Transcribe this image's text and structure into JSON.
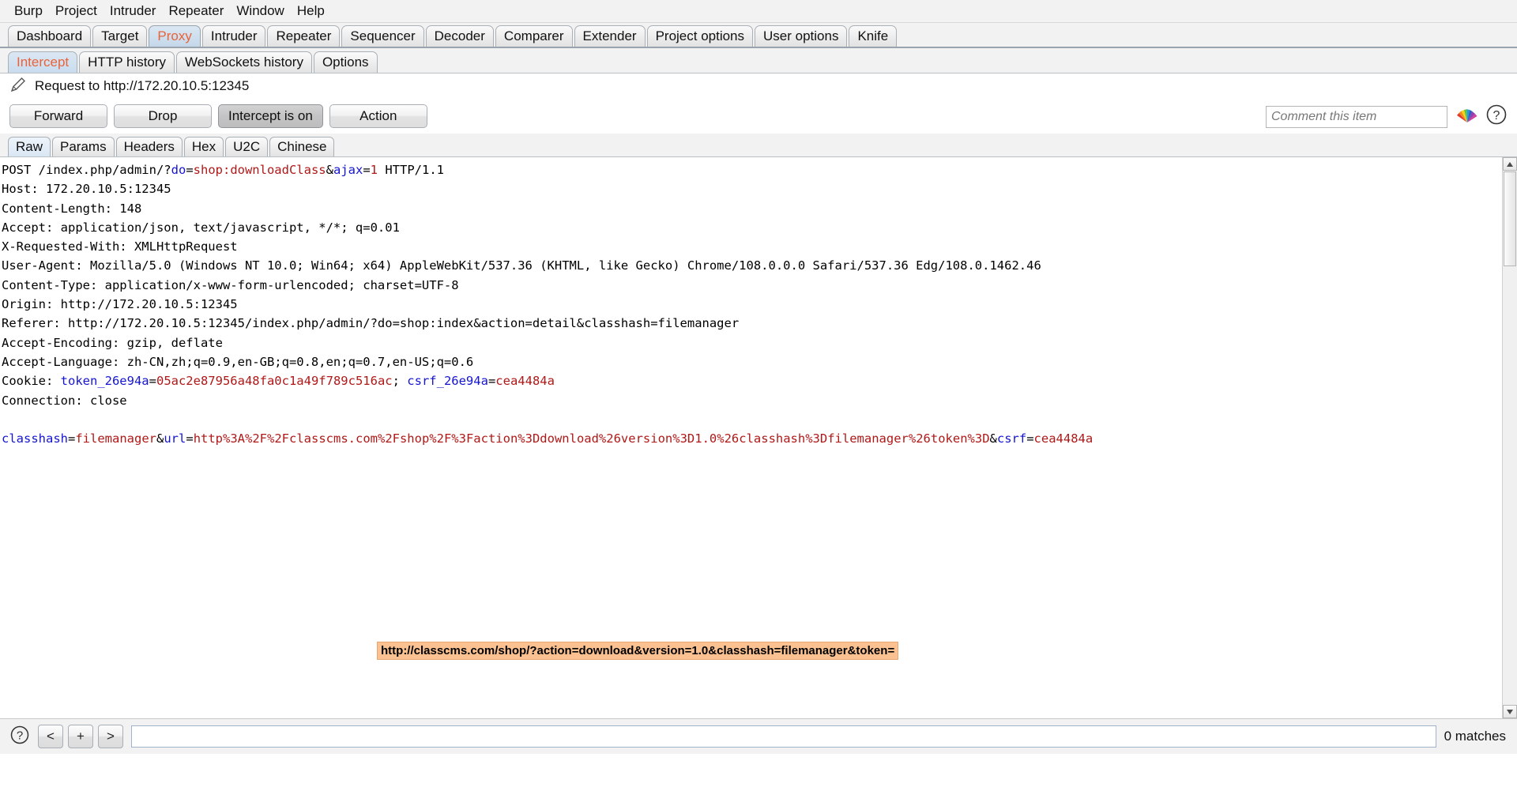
{
  "menubar": {
    "items": [
      "Burp",
      "Project",
      "Intruder",
      "Repeater",
      "Window",
      "Help"
    ]
  },
  "main_tabs": {
    "selected": "Proxy",
    "items": [
      "Dashboard",
      "Target",
      "Proxy",
      "Intruder",
      "Repeater",
      "Sequencer",
      "Decoder",
      "Comparer",
      "Extender",
      "Project options",
      "User options",
      "Knife"
    ]
  },
  "sub_tabs": {
    "selected": "Intercept",
    "items": [
      "Intercept",
      "HTTP history",
      "WebSockets history",
      "Options"
    ]
  },
  "request_header": {
    "icon": "pencil-icon",
    "title": "Request to http://172.20.10.5:12345"
  },
  "action_bar": {
    "forward_label": "Forward",
    "drop_label": "Drop",
    "intercept_label": "Intercept is on",
    "action_label": "Action",
    "comment_placeholder": "Comment this item",
    "comment_value": "",
    "fan_icon": "highlighter-fan-icon",
    "help_icon": "help-icon"
  },
  "editor_tabs": {
    "selected": "Raw",
    "items": [
      "Raw",
      "Params",
      "Headers",
      "Hex",
      "U2C",
      "Chinese"
    ]
  },
  "request": {
    "lines": [
      [
        {
          "t": "POST /index.php/admin/?",
          "c": "plain"
        },
        {
          "t": "do",
          "c": "blue"
        },
        {
          "t": "=",
          "c": "plain"
        },
        {
          "t": "shop:downloadClass",
          "c": "red"
        },
        {
          "t": "&",
          "c": "plain"
        },
        {
          "t": "ajax",
          "c": "blue"
        },
        {
          "t": "=",
          "c": "plain"
        },
        {
          "t": "1",
          "c": "red"
        },
        {
          "t": " HTTP/1.1",
          "c": "plain"
        }
      ],
      [
        {
          "t": "Host: 172.20.10.5:12345",
          "c": "plain"
        }
      ],
      [
        {
          "t": "Content-Length: 148",
          "c": "plain"
        }
      ],
      [
        {
          "t": "Accept: application/json, text/javascript, */*; q=0.01",
          "c": "plain"
        }
      ],
      [
        {
          "t": "X-Requested-With: XMLHttpRequest",
          "c": "plain"
        }
      ],
      [
        {
          "t": "User-Agent: Mozilla/5.0 (Windows NT 10.0; Win64; x64) AppleWebKit/537.36 (KHTML, like Gecko) Chrome/108.0.0.0 Safari/537.36 Edg/108.0.1462.46",
          "c": "plain"
        }
      ],
      [
        {
          "t": "Content-Type: application/x-www-form-urlencoded; charset=UTF-8",
          "c": "plain"
        }
      ],
      [
        {
          "t": "Origin: http://172.20.10.5:12345",
          "c": "plain"
        }
      ],
      [
        {
          "t": "Referer: http://172.20.10.5:12345/index.php/admin/?do=shop:index&action=detail&classhash=filemanager",
          "c": "plain"
        }
      ],
      [
        {
          "t": "Accept-Encoding: gzip, deflate",
          "c": "plain"
        }
      ],
      [
        {
          "t": "Accept-Language: zh-CN,zh;q=0.9,en-GB;q=0.8,en;q=0.7,en-US;q=0.6",
          "c": "plain"
        }
      ],
      [
        {
          "t": "Cookie: ",
          "c": "plain"
        },
        {
          "t": "token_26e94a",
          "c": "blue"
        },
        {
          "t": "=",
          "c": "plain"
        },
        {
          "t": "05ac2e87956a48fa0c1a49f789c516ac",
          "c": "red"
        },
        {
          "t": "; ",
          "c": "plain"
        },
        {
          "t": "csrf_26e94a",
          "c": "blue"
        },
        {
          "t": "=",
          "c": "plain"
        },
        {
          "t": "cea4484a",
          "c": "red"
        }
      ],
      [
        {
          "t": "Connection: close",
          "c": "plain"
        }
      ],
      [
        {
          "t": "",
          "c": "plain"
        }
      ],
      [
        {
          "t": "classhash",
          "c": "blue"
        },
        {
          "t": "=",
          "c": "plain"
        },
        {
          "t": "filemanager",
          "c": "red"
        },
        {
          "t": "&",
          "c": "plain"
        },
        {
          "t": "url",
          "c": "blue"
        },
        {
          "t": "=",
          "c": "plain"
        },
        {
          "t": "http%3A%2F%2Fclasscms.com%2Fshop%2F%3Faction%3Ddownload%26version%3D1.0%26classhash%3Dfilemanager%26token%3D",
          "c": "red"
        },
        {
          "t": "&",
          "c": "plain"
        },
        {
          "t": "csrf",
          "c": "blue"
        },
        {
          "t": "=",
          "c": "plain"
        },
        {
          "t": "cea4484a",
          "c": "red"
        }
      ]
    ]
  },
  "tooltip": {
    "text": "http://classcms.com/shop/?action=download&version=1.0&classhash=filemanager&token="
  },
  "footer": {
    "help_icon": "help-icon",
    "prev_label": "<",
    "add_label": "+",
    "next_label": ">",
    "search_value": "",
    "search_placeholder": "",
    "matches_label": "0 matches"
  },
  "colors": {
    "accent_orange": "#e8633a",
    "param_blue": "#1414d2",
    "value_red": "#b01818",
    "tooltip_bg": "#fbc191"
  }
}
